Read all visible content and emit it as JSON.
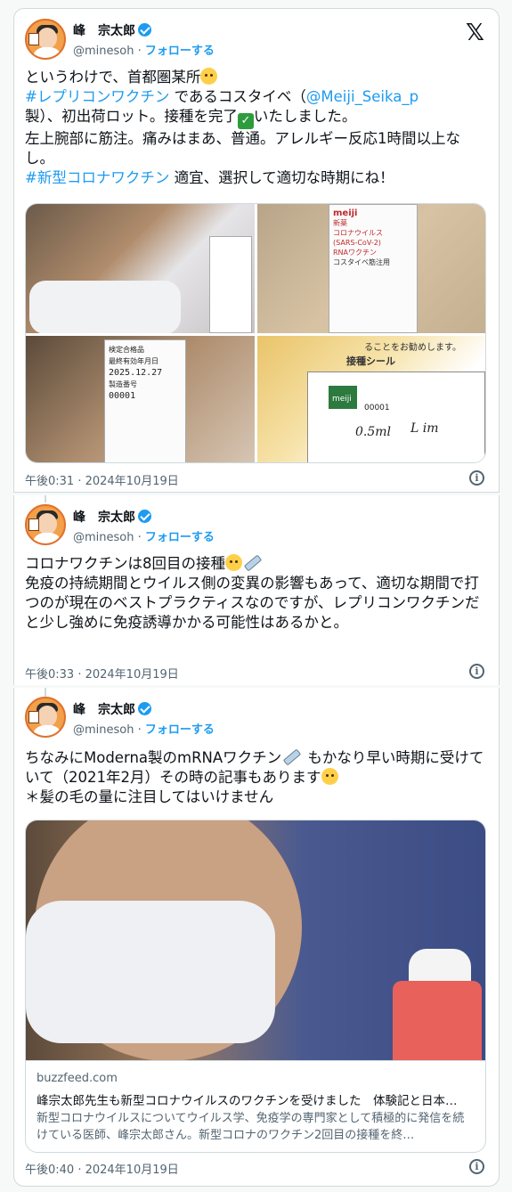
{
  "user": {
    "name": "峰　宗太郎",
    "handle": "@minesoh",
    "follow_label": "フォローする",
    "separator": "·"
  },
  "tweet1": {
    "line1": "というわけで、首都圏某所",
    "hashtag_replicon": "#レプリコンワクチン",
    "line2_mid": " であるコスタイベ（",
    "mention": "@Meiji_Seika_p",
    "line3": "製）、初出荷ロット。接種を完了",
    "line3_end": "いたしました。",
    "line4": "左上腕部に筋注。痛みはまあ、普通。アレルギー反応1時間以上なし。",
    "hashtag_corona": "#新型コロナワクチン",
    "line5_end": " 適宜、選択して適切な時期にね！",
    "check_glyph": "✓",
    "timestamp": "午後0:31 · 2024年10月19日"
  },
  "tweet2": {
    "line1": "コロナワクチンは8回目の接種",
    "line2": "免疫の持続期間とウイルス側の変異の影響もあって、適切な期間で打つのが現在のベストプラクティスなのですが、レプリコンワクチンだと少し強めに免疫誘導かかる可能性はあるかと。",
    "timestamp": "午後0:33 · 2024年10月19日"
  },
  "tweet3": {
    "line1": "ちなみにModerna製のmRNAワクチン",
    "line1_end": " もかなり早い時期に受けていて（2021年2月）その時の記事もあります",
    "line2": "＊髪の毛の量に注目してはいけません",
    "link_domain": "buzzfeed.com",
    "link_title": "峰宗太郎先生も新型コロナウイルスのワクチンを受けました　体験記と日本…",
    "link_desc": "新型コロナウイルスについてウイルス学、免疫学の専門家として積極的に発信を続けている医師、峰宗太郎さん。新型コロナのワクチン2回目の接種を終…",
    "timestamp": "午後0:40 · 2024年10月19日"
  },
  "photo_text": {
    "box_label": "新薬",
    "box_brand": "meiji",
    "box_lines": [
      "コロナウイルス",
      "(SARS-CoV-2)",
      "RNAワクチン",
      "コスタイベ筋注用"
    ],
    "lot_header": "検定合格品",
    "lot_expiry_label": "最終有効年月日",
    "lot_date": "2025.12.27",
    "lot_number_label": "製造番号",
    "lot_number": "00001",
    "sticker_header": "接種シール",
    "sticker_top": "ることをお勧めします。",
    "sticker_brand": "meiji",
    "sticker_number": "00001",
    "sticker_note": "0.5ml",
    "sticker_site": "L im"
  },
  "icons": {
    "x_logo": "𝕏",
    "info": "i"
  },
  "colors": {
    "link": "#1d9bf0",
    "text": "#0f1419",
    "muted": "#536471",
    "border": "#cfd9de"
  }
}
